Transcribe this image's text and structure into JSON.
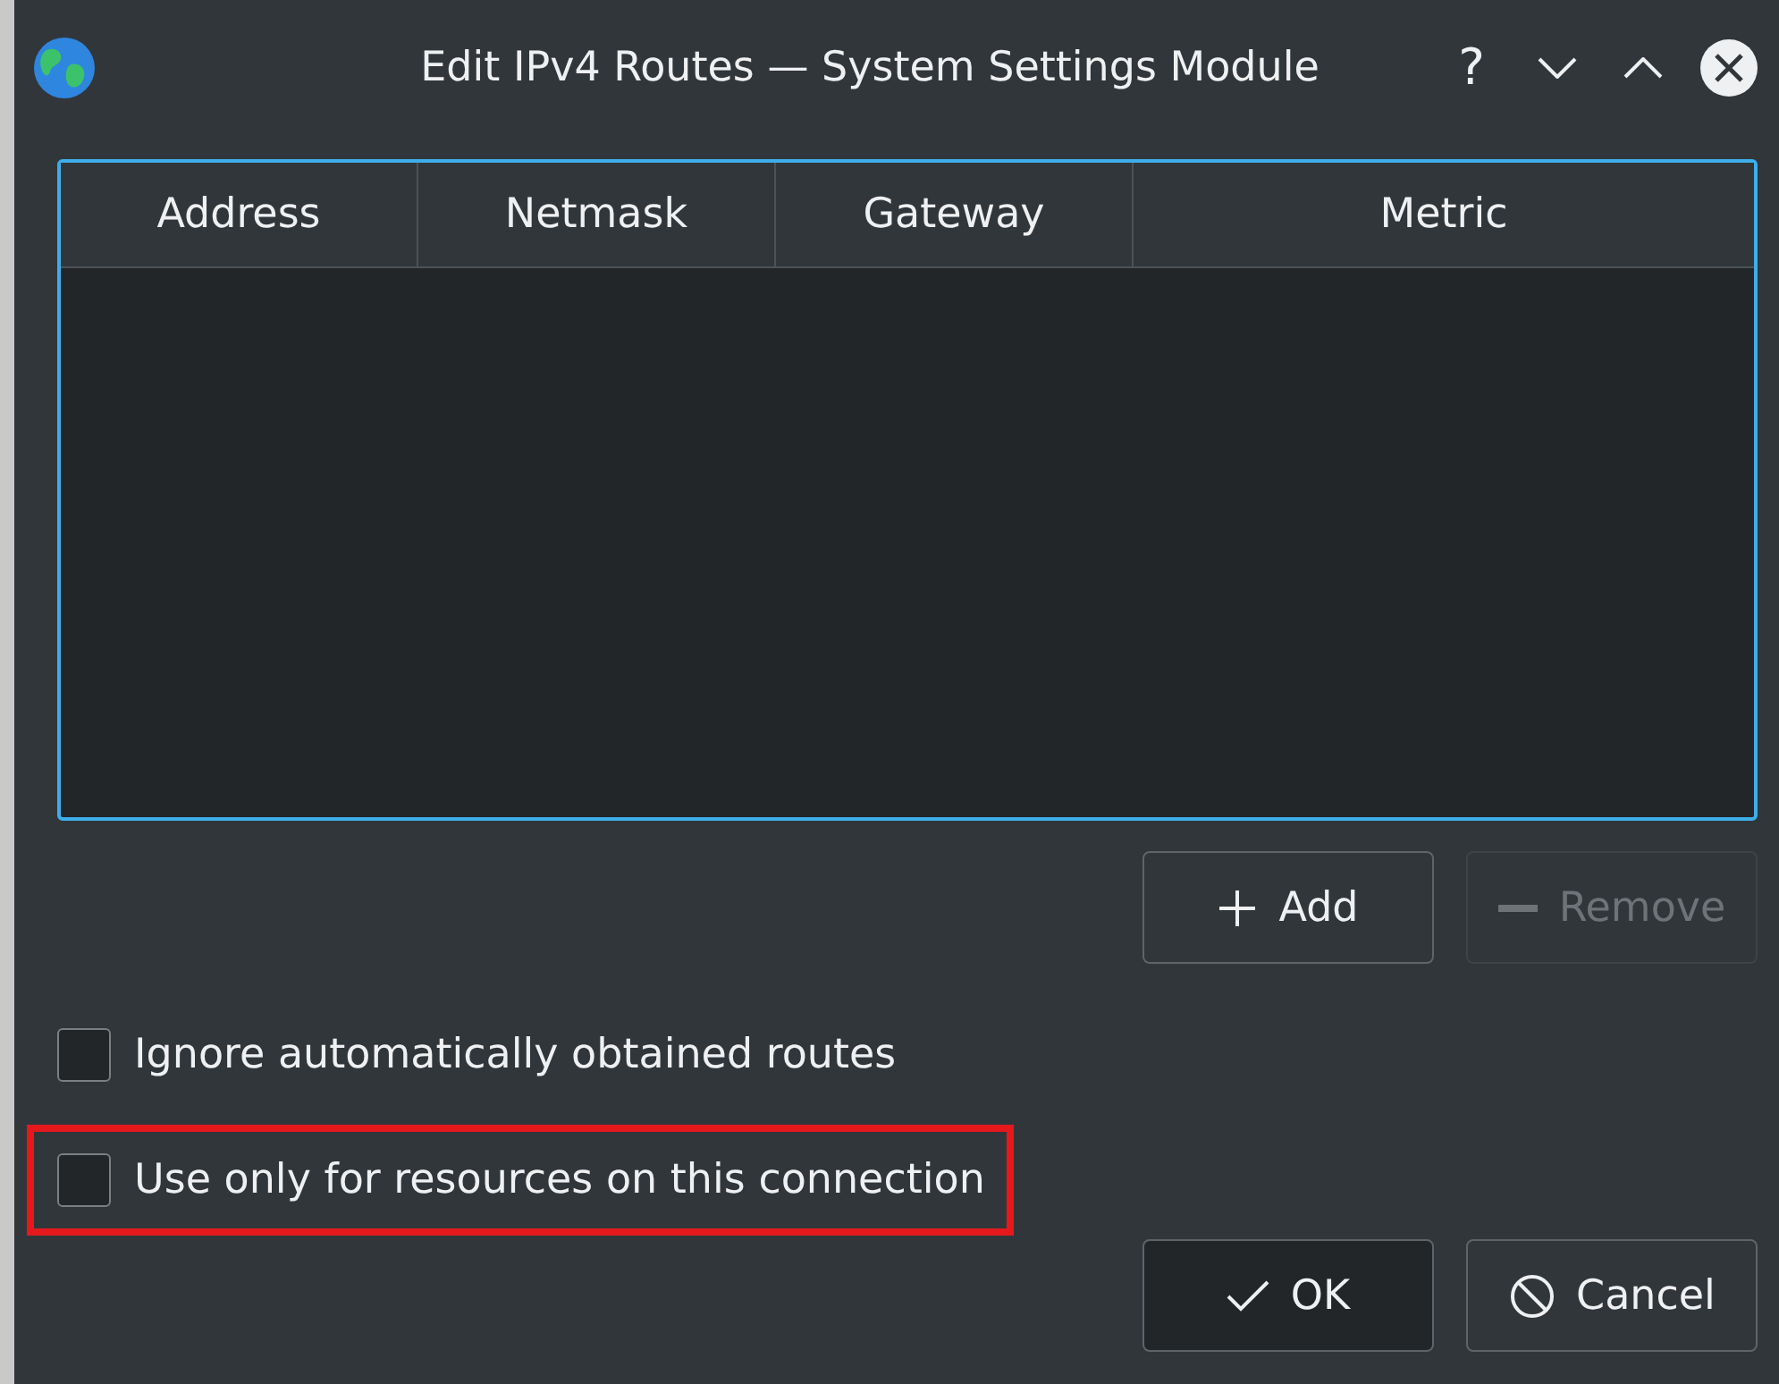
{
  "window": {
    "title": "Edit IPv4 Routes — System Settings Module",
    "controls": [
      {
        "kind": "help",
        "label": "?"
      },
      {
        "kind": "minimize"
      },
      {
        "kind": "maximize"
      },
      {
        "kind": "close"
      }
    ]
  },
  "table": {
    "columns": [
      "Address",
      "Netmask",
      "Gateway",
      "Metric"
    ],
    "focused": true
  },
  "table_buttons": [
    {
      "kind": "add",
      "label": "Add",
      "disabled": false
    },
    {
      "kind": "remove",
      "label": "Remove",
      "disabled": true
    }
  ],
  "options": [
    {
      "label": "Ignore automatically obtained routes",
      "checked": false,
      "highlighted": false
    },
    {
      "label": "Use only for resources on this connection",
      "checked": false,
      "highlighted": true
    }
  ],
  "dialog_buttons": [
    {
      "kind": "ok",
      "label": "OK",
      "default": true
    },
    {
      "kind": "cancel",
      "label": "Cancel",
      "default": false
    }
  ]
}
